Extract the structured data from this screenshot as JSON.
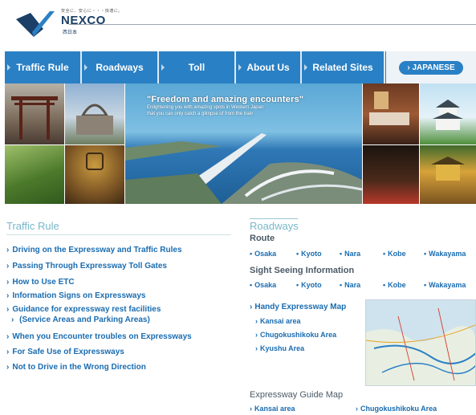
{
  "header": {
    "logo_tagline": "安全に、安心に・・・快適に。",
    "logo_text": "NEXCO",
    "logo_sub": "西日本"
  },
  "nav": {
    "items": [
      {
        "label": "Traffic Rule"
      },
      {
        "label": "Roadways"
      },
      {
        "label": "Toll"
      },
      {
        "label": "About Us"
      },
      {
        "label": "Related Sites"
      }
    ],
    "language_button": "› JAPANESE"
  },
  "banner": {
    "title": "\"Freedom and amazing encounters\"",
    "line1": "Enlightening you with amazing spots in Western Japan",
    "line2": "that you can only catch a glimpse of from the train"
  },
  "traffic_rule": {
    "title": "Traffic Rule",
    "links": [
      "Driving on the Expressway and Traffic Rules",
      "Passing Through Expressway Toll Gates",
      "How to Use ETC",
      "Information Signs on Expressways",
      "Guidance for expressway rest facilities",
      "(Service Areas and Parking Areas)",
      "When you Encounter troubles on Expressways",
      "For Safe Use of Expressways",
      "Not to Drive in the Wrong Direction"
    ]
  },
  "roadways": {
    "title": "Roadways",
    "route_heading": "Route",
    "route_cities": [
      "Osaka",
      "Kyoto",
      "Nara",
      "Kobe",
      "Wakayama"
    ],
    "sightseeing_heading": "Sight Seeing Information",
    "sightseeing_cities": [
      "Osaka",
      "Kyoto",
      "Nara",
      "Kobe",
      "Wakayama"
    ],
    "handy_map": "Handy Expressway Map",
    "handy_areas": [
      "Kansai  area",
      "Chugokushikoku Area",
      "Kyushu Area"
    ],
    "guide_heading": "Expressway Guide Map",
    "guide_areas": [
      "Kansai  area",
      "Chugokushikoku Area"
    ]
  },
  "colors": {
    "nav_blue": "#2a80c4",
    "link_blue": "#1a6cb0",
    "section_title": "#79b7c8",
    "brand_navy": "#1b3f66"
  }
}
